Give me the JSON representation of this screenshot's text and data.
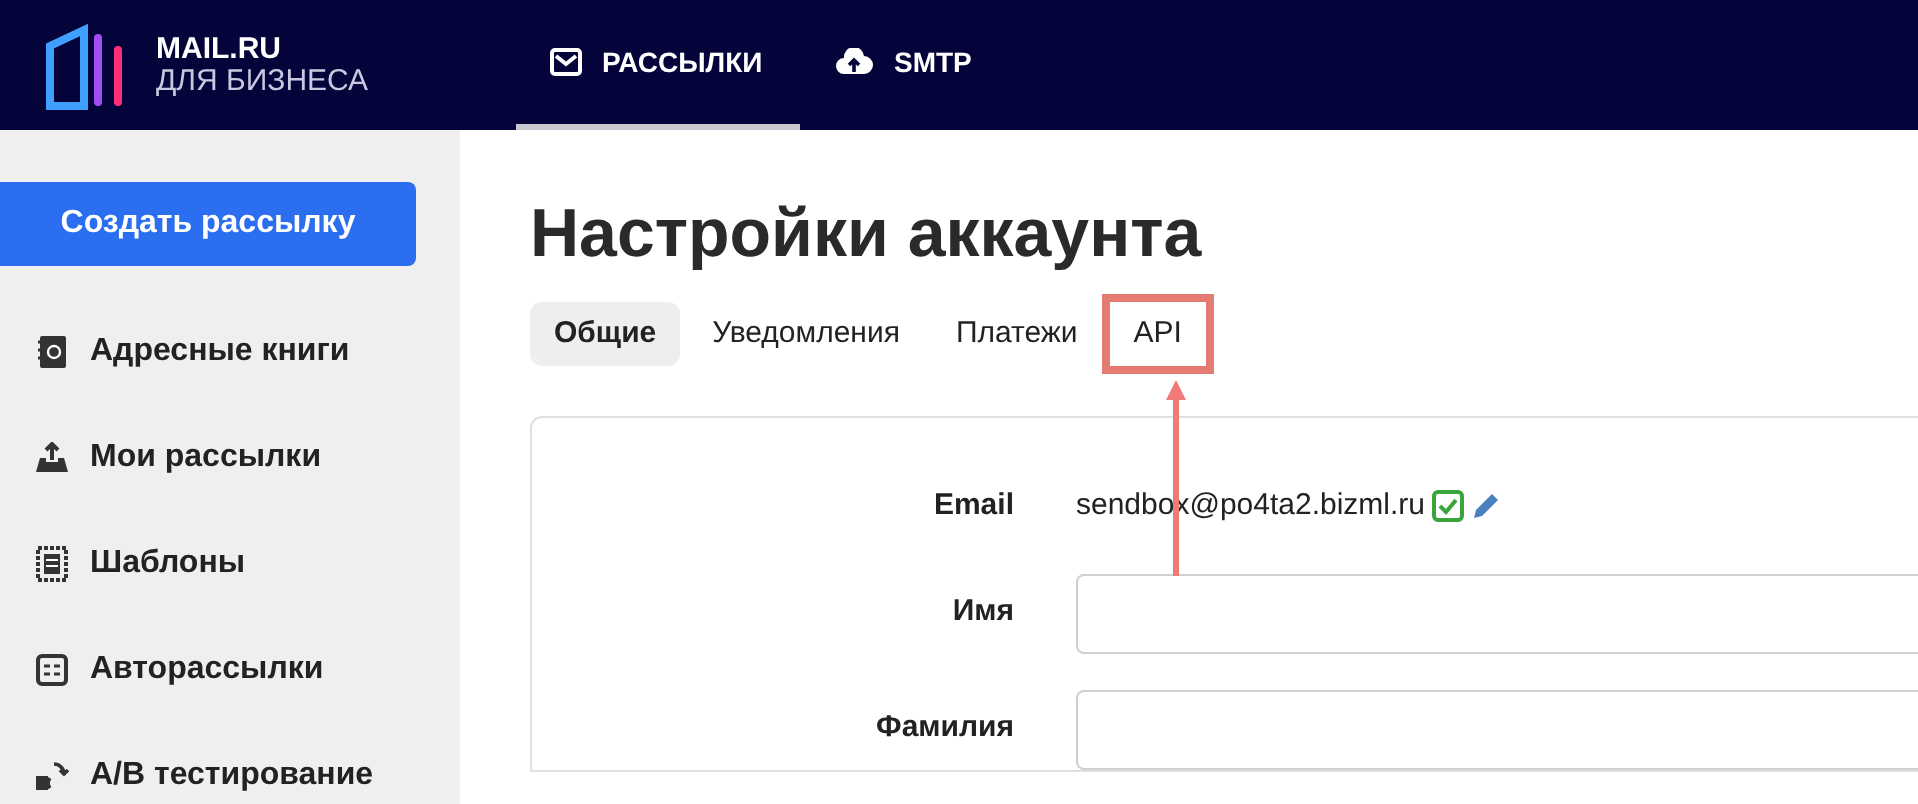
{
  "logo": {
    "line_1": "MAIL.RU",
    "line_2": "ДЛЯ БИЗНЕСА"
  },
  "nav": [
    {
      "kind": "mail",
      "label": "РАССЫЛКИ",
      "selected": true
    },
    {
      "kind": "cloud",
      "label": "SMTP",
      "selected": false
    }
  ],
  "sidebar": {
    "create_button": "Создать рассылку",
    "items": [
      {
        "kind": "book",
        "label": "Адресные книги"
      },
      {
        "kind": "upload",
        "label": "Мои рассылки"
      },
      {
        "kind": "template",
        "label": "Шаблоны"
      },
      {
        "kind": "auto",
        "label": "Авторассылки"
      },
      {
        "kind": "ab",
        "label": "A/B тестирование"
      }
    ]
  },
  "page_title": "Настройки аккаунта",
  "tabs": [
    {
      "label": "Общие",
      "selected": true,
      "highlighted": false
    },
    {
      "label": "Уведомления",
      "selected": false,
      "highlighted": false
    },
    {
      "label": "Платежи",
      "selected": false,
      "highlighted": false
    },
    {
      "label": "API",
      "selected": false,
      "highlighted": true
    }
  ],
  "form": [
    {
      "kind": "text",
      "label": "Email",
      "value": "sendbox@po4ta2.bizml.ru",
      "verified": true
    },
    {
      "kind": "input",
      "label": "Имя"
    },
    {
      "kind": "input",
      "label": "Фамилия"
    }
  ]
}
